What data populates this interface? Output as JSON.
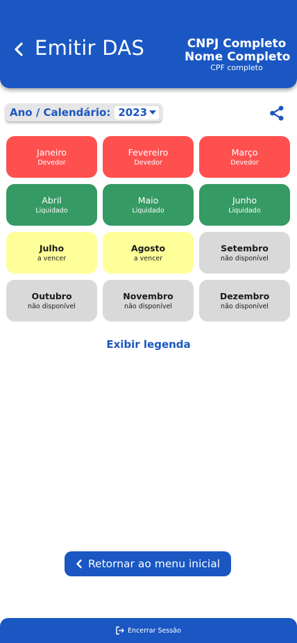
{
  "header": {
    "title": "Emitir DAS",
    "cnpj": "CNPJ Completo",
    "nome": "Nome Completo",
    "cpf": "CPF completo",
    "back_icon": "chevron-left-icon"
  },
  "colors": {
    "primary": "#1A57C2",
    "devedor": "#FF5050",
    "liquidado": "#359A63",
    "a_vencer": "#FFFF99",
    "nao_disponivel": "#D9D9D9"
  },
  "year_selector": {
    "label": "Ano / Calendário:",
    "value": "2023"
  },
  "share_icon": "share-icon",
  "months": [
    {
      "name": "Janeiro",
      "status": "Devedor"
    },
    {
      "name": "Fevereiro",
      "status": "Devedor"
    },
    {
      "name": "Março",
      "status": "Devedor"
    },
    {
      "name": "Abril",
      "status": "Liquidado"
    },
    {
      "name": "Maio",
      "status": "Liquidado"
    },
    {
      "name": "Junho",
      "status": "Liquidado"
    },
    {
      "name": "Julho",
      "status": "a vencer"
    },
    {
      "name": "Agosto",
      "status": "a vencer"
    },
    {
      "name": "Setembro",
      "status": "não disponível"
    },
    {
      "name": "Outubro",
      "status": "não disponível"
    },
    {
      "name": "Novembro",
      "status": "não disponível"
    },
    {
      "name": "Dezembro",
      "status": "não disponível"
    }
  ],
  "legend_link": "Exibir legenda",
  "return_button": "Retornar ao menu inicial",
  "footer": {
    "label": "Encerrar Sessão",
    "icon": "logout-icon"
  }
}
